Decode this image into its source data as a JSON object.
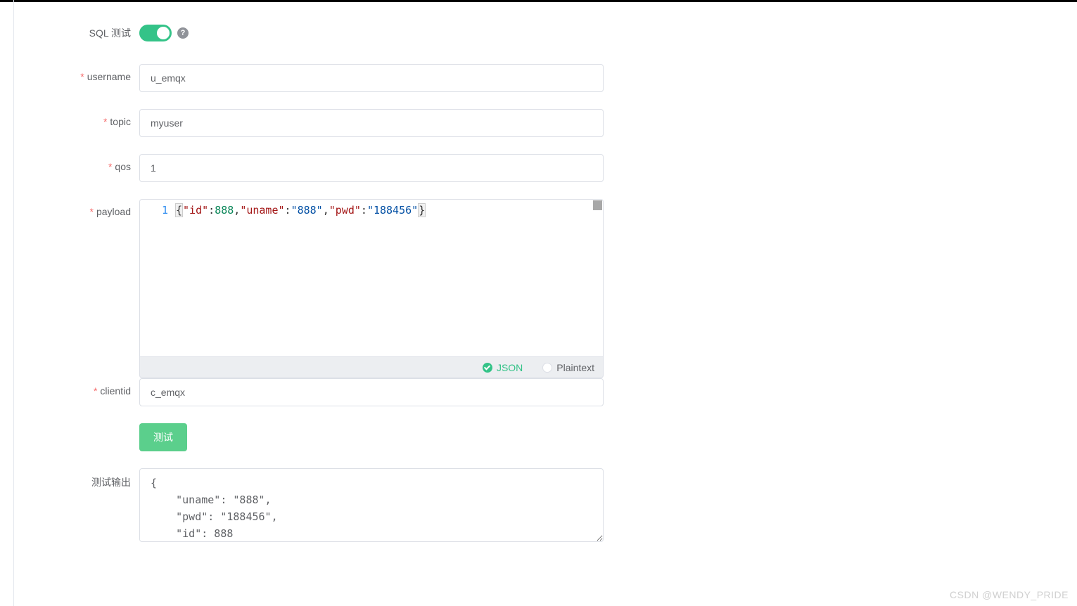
{
  "form": {
    "sql_test_label": "SQL 测试",
    "labels": {
      "username": "username",
      "topic": "topic",
      "qos": "qos",
      "payload": "payload",
      "clientid": "clientid",
      "output": "测试输出"
    },
    "values": {
      "username": "u_emqx",
      "topic": "myuser",
      "qos": "1",
      "clientid": "c_emqx"
    },
    "payload": {
      "line_number": "1",
      "tokens": {
        "open": "{",
        "k_id": "\"id\"",
        "v_id": "888",
        "k_uname": "\"uname\"",
        "v_uname": "\"888\"",
        "k_pwd": "\"pwd\"",
        "v_pwd": "\"188456\"",
        "close": "}"
      },
      "format_json": "JSON",
      "format_plaintext": "Plaintext"
    },
    "test_button": "测试",
    "output_text": "{\n    \"uname\": \"888\",\n    \"pwd\": \"188456\",\n    \"id\": 888"
  },
  "watermark": "CSDN @WENDY_PRIDE"
}
